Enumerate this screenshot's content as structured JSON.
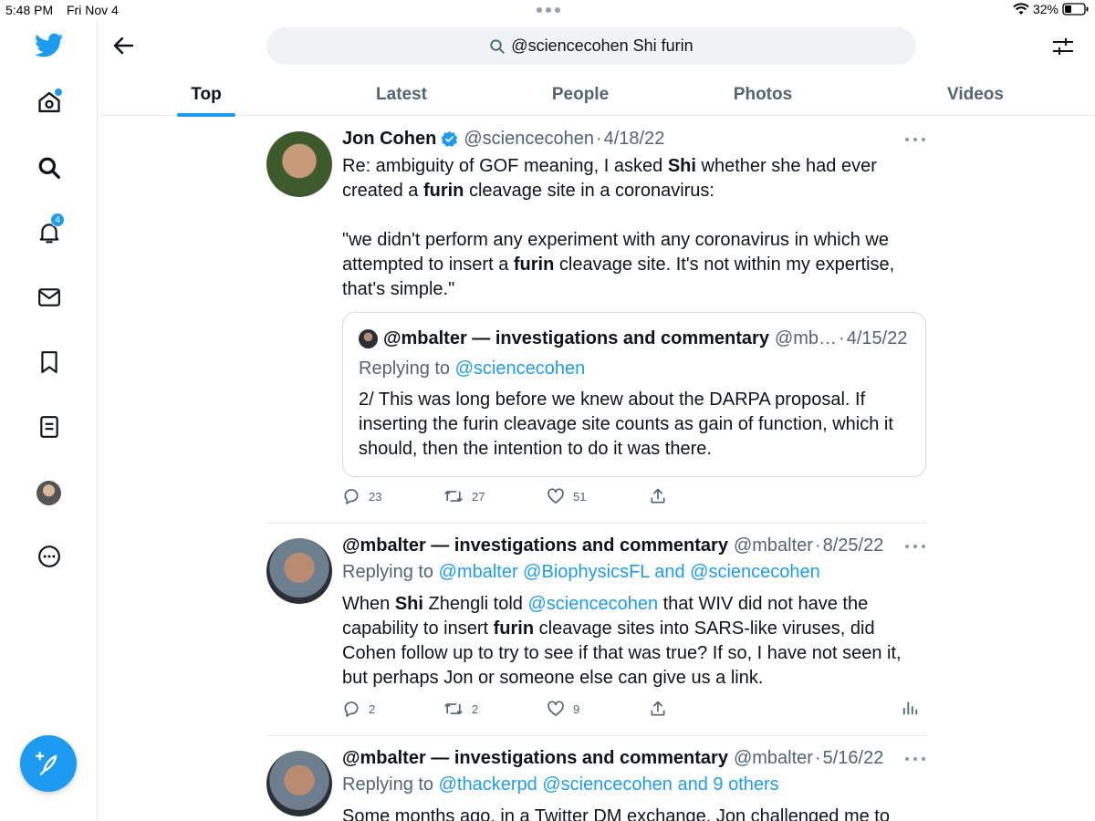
{
  "status_bar": {
    "time": "5:48 PM",
    "date": "Fri Nov 4",
    "battery": "32%"
  },
  "colors": {
    "accent": "#1d9bf0",
    "text": "#0f1419",
    "muted": "#536471",
    "border": "#e6ecf0"
  },
  "nav": {
    "icons": [
      "twitter-logo-icon",
      "home-icon",
      "explore-search-icon",
      "notifications-bell-icon",
      "messages-envelope-icon",
      "bookmark-icon",
      "lists-icon",
      "profile-avatar",
      "more-circle-icon",
      "compose-tweet-icon"
    ],
    "notification_count": "4"
  },
  "search": {
    "query": "@sciencecohen Shi furin"
  },
  "tabs": [
    {
      "label": "Top",
      "active": true
    },
    {
      "label": "Latest",
      "active": false
    },
    {
      "label": "People",
      "active": false
    },
    {
      "label": "Photos",
      "active": false
    },
    {
      "label": "Videos",
      "active": false
    }
  ],
  "tweets": [
    {
      "name": "Jon Cohen",
      "handle": "@sciencecohen",
      "date": "4/18/22",
      "verified": true,
      "body": {
        "p1a": "Re: ambiguity of GOF meaning, I asked ",
        "p1b": "Shi",
        "p1c": " whether she had ever created a ",
        "p1d": "furin",
        "p1e": " cleavage site in a coronavirus:",
        "p2a": "\"we didn't perform any experiment with any coronavirus in which we attempted to insert a ",
        "p2b": "furin",
        "p2c": " cleavage site. It's not within my expertise, that's simple.\""
      },
      "quote": {
        "name": "@mbalter — investigations and commentary",
        "handle": "@mb…",
        "date": "4/15/22",
        "replying_prefix": "Replying to ",
        "replying_to": "@sciencecohen",
        "body": "2/ This was long before we knew about the DARPA proposal. If inserting the furin cleavage site counts as gain of function, which it should, then the intention to do it was there."
      },
      "replies": "23",
      "retweets": "27",
      "likes": "51"
    },
    {
      "name": "@mbalter — investigations and commentary",
      "handle": "@mbalter",
      "date": "8/25/22",
      "replying_prefix": "Replying to ",
      "replying_to": "@mbalter @BiophysicsFL and @sciencecohen",
      "body": {
        "a": "When ",
        "b": "Shi",
        "c": " Zhengli told ",
        "d": "@sciencecohen",
        "e": " that WIV did not have the capability to insert ",
        "f": "furin",
        "g": " cleavage sites into SARS-like viruses, did Cohen follow up to try to see if that was true? If so, I have not seen it, but perhaps Jon or someone else can give us a link."
      },
      "replies": "2",
      "retweets": "2",
      "likes": "9"
    },
    {
      "name": "@mbalter — investigations and commentary",
      "handle": "@mbalter",
      "date": "5/16/22",
      "replying_prefix": "Replying to ",
      "replying_to": "@thackerpd @sciencecohen and 9 others",
      "body": "Some months ago, in a Twitter DM exchange, Jon challenged me to"
    }
  ]
}
